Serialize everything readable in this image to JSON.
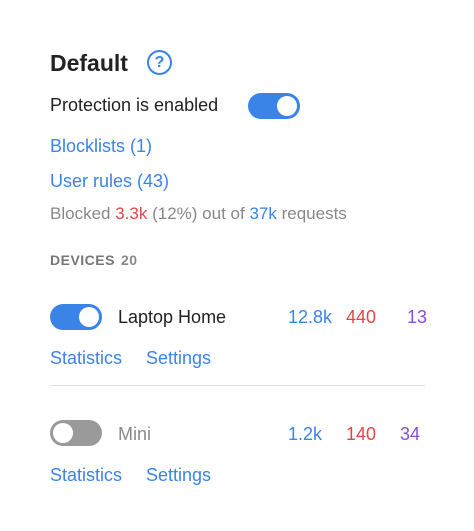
{
  "header": {
    "title": "Default"
  },
  "protection": {
    "label": "Protection is enabled",
    "enabled": true
  },
  "links": {
    "blocklists": "Blocklists (1)",
    "user_rules": "User rules (43)"
  },
  "summary": {
    "prefix": "Blocked",
    "blocked": "3.3k",
    "percent": "(12%) out of",
    "total": "37k",
    "suffix": "requests"
  },
  "devices": {
    "label": "DEVICES",
    "count": "20",
    "items": [
      {
        "name": "Laptop Home",
        "enabled": true,
        "stat_blue": "12.8k",
        "stat_red": "440",
        "stat_purple": "13",
        "statistics_label": "Statistics",
        "settings_label": "Settings"
      },
      {
        "name": "Mini",
        "enabled": false,
        "stat_blue": "1.2k",
        "stat_red": "140",
        "stat_purple": "34",
        "statistics_label": "Statistics",
        "settings_label": "Settings"
      }
    ]
  },
  "colors": {
    "accent": "#3a84e8",
    "red": "#e04848",
    "purple": "#8a4fd6",
    "toggle_off": "#9a9a9a"
  },
  "icons": {
    "help": "help-circle-icon"
  }
}
